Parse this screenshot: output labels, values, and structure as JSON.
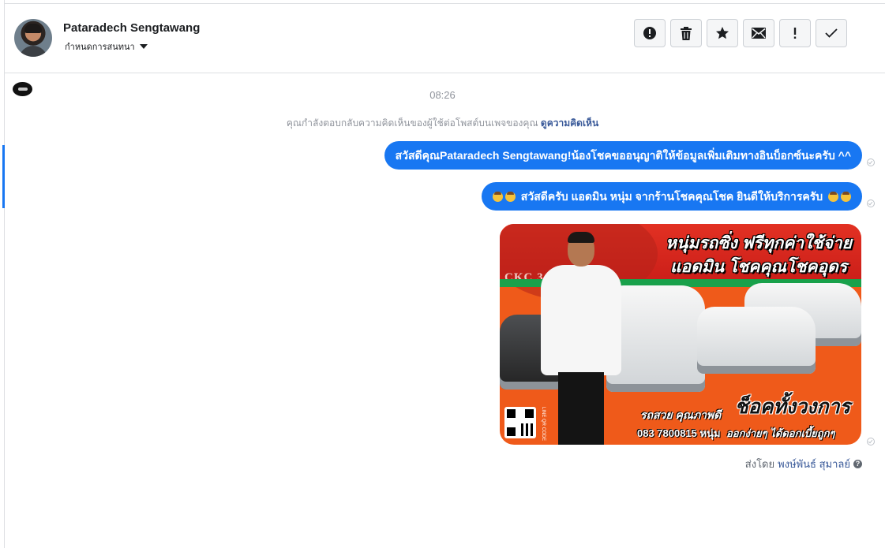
{
  "header": {
    "contact_name": "Pataradech Sengtawang",
    "assign_label": "กำหนดการสนทนา",
    "toolbar": [
      {
        "icon": "alert-circle-icon",
        "label": ""
      },
      {
        "icon": "trash-icon",
        "label": ""
      },
      {
        "icon": "star-icon",
        "label": ""
      },
      {
        "icon": "envelope-icon",
        "label": ""
      },
      {
        "icon": "exclamation-icon",
        "label": ""
      },
      {
        "icon": "checkmark-icon",
        "label": ""
      }
    ]
  },
  "conversation": {
    "timestamp": "08:26",
    "notice_text": "คุณกำลังตอบกลับความคิดเห็นของผู้ใช้ต่อโพสต์บนเพจของคุณ",
    "notice_link": "ดูความคิดเห็น",
    "messages": [
      {
        "text": "สวัสดีคุณPataradech Sengtawang!น้องโชคขออนุญาติให้ข้อมูลเพิ่มเติมทางอินบ็อกซ์นะครับ ^^"
      },
      {
        "text": "สวัสดีครับ แอดมิน หนุ่ม จากร้านโชคคุณโชค ยินดีให้บริการครับ"
      }
    ],
    "image_ad": {
      "logo_text": "CKC 3",
      "headline_1": "หนุ่มรถซิ่ง ฟรีทุกค่าใช้จ่าย",
      "headline_2": "แอดมิน โชคคุณโชคอุดร",
      "slogan": "ช็อคทั้งวงการ",
      "line_1": "รถสวย คุณภาพดี",
      "phone": "083 7800815 หนุ่ม",
      "line_3": "ออกง่ายๆ ได้ดอกเบี้ยถูกๆ",
      "qr_label": "LINE QR CODE"
    },
    "sent_by_prefix": "ส่งโดย",
    "sent_by_name": "พงษ์พันธ์ สุมาลย์"
  },
  "colors": {
    "accent": "#1877f2",
    "link": "#385898",
    "muted": "#90949c"
  }
}
